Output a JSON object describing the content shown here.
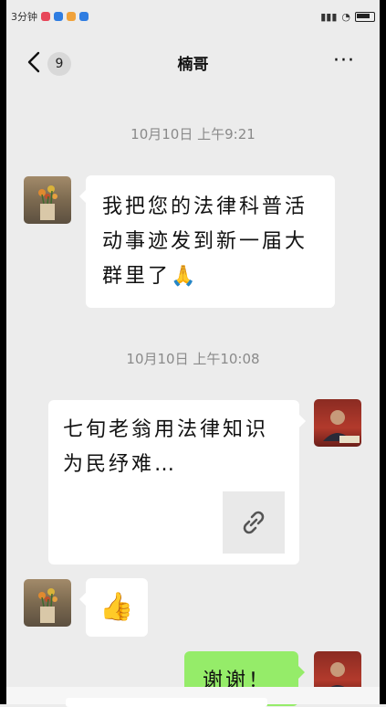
{
  "status_bar": {
    "left_text": "3分钟",
    "right_text": ""
  },
  "nav": {
    "unread_badge": "9",
    "title": "楠哥",
    "more_label": "···"
  },
  "messages": [
    {
      "type": "time",
      "text": "10月10日  上午9:21"
    },
    {
      "type": "text",
      "side": "left",
      "text": "我把您的法律科普活动事迹发到新一届大群里了🙏"
    },
    {
      "type": "time",
      "text": "10月10日  上午10:08"
    },
    {
      "type": "link",
      "side": "right",
      "text": "七旬老翁用法律知识为民纾难…",
      "icon": "link-icon"
    },
    {
      "type": "emoji",
      "side": "left",
      "text": "👍"
    },
    {
      "type": "text",
      "side": "right",
      "text": "谢谢！"
    }
  ],
  "colors": {
    "background": "#ececec",
    "bubble_self": "#95ec69",
    "bubble_other": "#ffffff",
    "time_text": "#8a8a8a"
  }
}
